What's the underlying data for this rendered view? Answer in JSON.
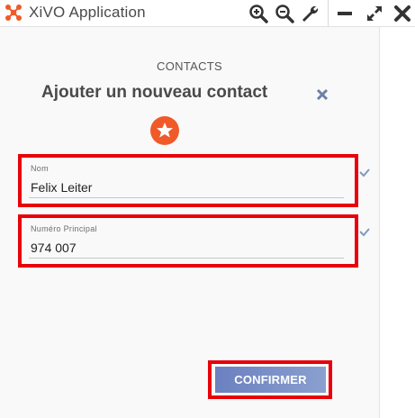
{
  "window": {
    "title": "XiVO Application",
    "icons": [
      "zoom-in-icon",
      "zoom-out-icon",
      "wrench-icon",
      "minimize-icon",
      "maximize-icon",
      "close-icon"
    ]
  },
  "form": {
    "section": "CONTACTS",
    "heading": "Ajouter un nouveau contact",
    "fields": [
      {
        "label": "Nom",
        "value": "Felix Leiter"
      },
      {
        "label": "Numéro Principal",
        "value": "974 007"
      }
    ],
    "confirm_label": "CONFIRMER"
  },
  "colors": {
    "brand": "#f05a28",
    "highlight": "#e8000b",
    "button": "#7b91c8",
    "check": "#7f9bbf"
  }
}
